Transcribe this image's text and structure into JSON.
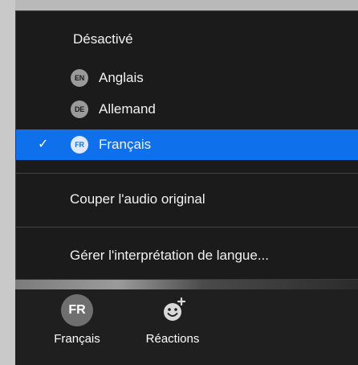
{
  "menu": {
    "off_label": "Désactivé",
    "languages": [
      {
        "badge": "EN",
        "label": "Anglais",
        "selected": false
      },
      {
        "badge": "DE",
        "label": "Allemand",
        "selected": false
      },
      {
        "badge": "FR",
        "label": "Français",
        "selected": true
      }
    ],
    "check_symbol": "✓",
    "mute_original": "Couper l'audio original",
    "manage": "Gérer l'interprétation de langue..."
  },
  "toolbar": {
    "language_badge": "FR",
    "language_label": "Français",
    "reactions_label": "Réactions",
    "reactions_icon": "emoji-add-icon"
  },
  "colors": {
    "accent": "#0e71eb",
    "menu_bg": "#1b1b1b",
    "toolbar_bg": "#1f1f1f"
  }
}
